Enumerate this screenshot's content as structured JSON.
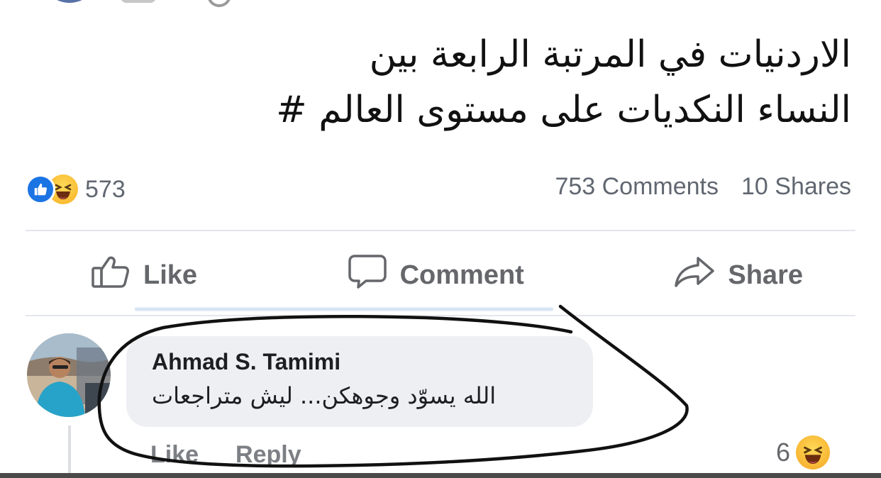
{
  "post": {
    "text_lines": [
      "الاردنيات في المرتبة الرابعة بين",
      "النساء النكديات على مستوى العالم #"
    ]
  },
  "stats": {
    "reactions_count": "573",
    "comments": "753 Comments",
    "shares": "10 Shares"
  },
  "actions": {
    "like": "Like",
    "comment": "Comment",
    "share": "Share"
  },
  "comment": {
    "author": "Ahmad S. Tamimi",
    "text": "الله يسوّد وجوهكن... ليش متراجعات",
    "like": "Like",
    "reply": "Reply",
    "reaction_count": "6"
  },
  "icons": {
    "like_reaction": "like-reaction-icon",
    "haha_reaction": "haha-reaction-icon",
    "like_button": "thumbs-up-outline-icon",
    "comment_button": "speech-bubble-icon",
    "share_button": "share-arrow-icon"
  },
  "colors": {
    "accent_blue": "#1b74e4",
    "muted_text": "#65676b",
    "bubble_bg": "#edeff3",
    "haha_yellow": "#f7b125",
    "ink_annotation": "#111111"
  }
}
